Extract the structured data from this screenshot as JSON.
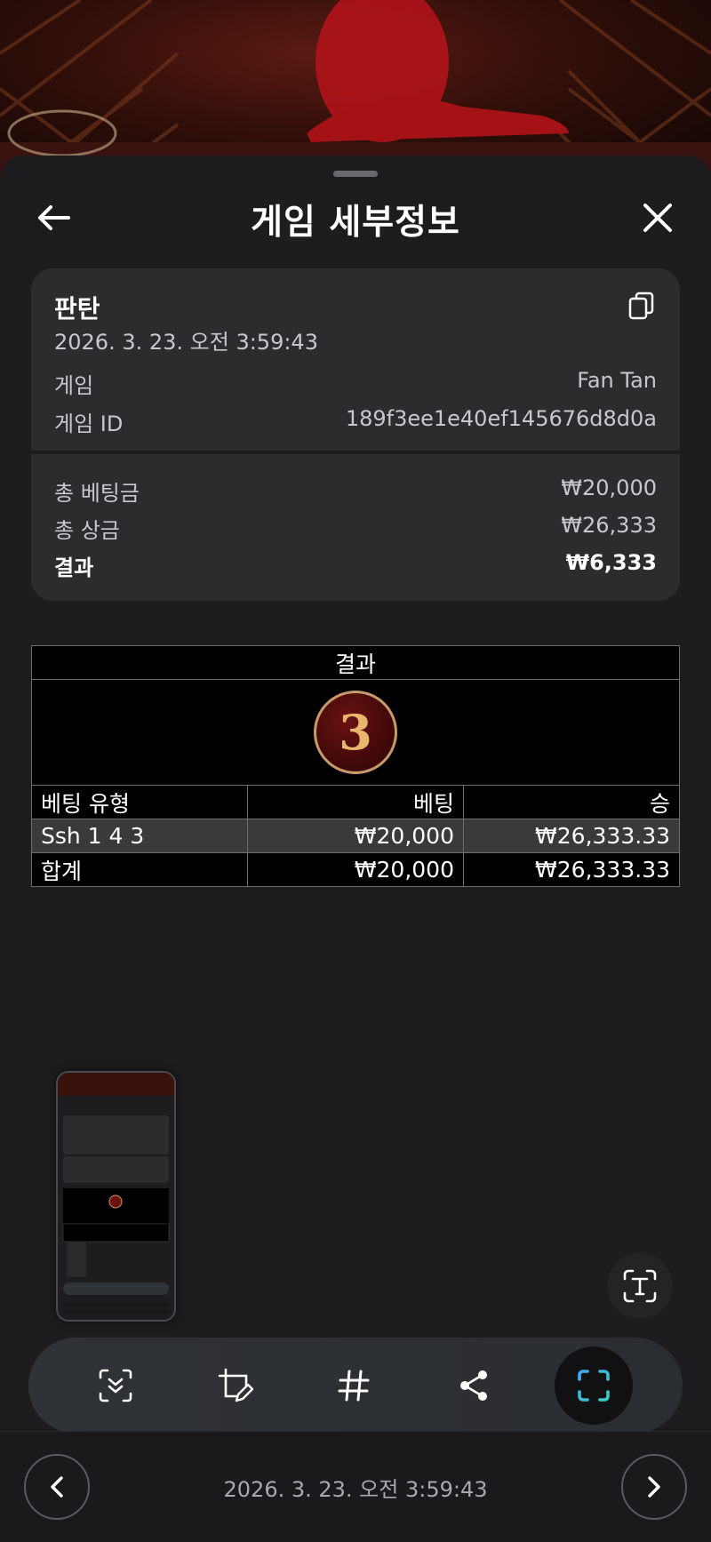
{
  "header": {
    "title": "게임 세부정보"
  },
  "summary": {
    "game_name": "판탄",
    "datetime": "2026. 3. 23. 오전 3:59:43",
    "game_label": "게임",
    "game_value": "Fan Tan",
    "game_id_label": "게임 ID",
    "game_id_value": "189f3ee1e40ef145676d8d0a",
    "total_bet_label": "총 베팅금",
    "total_bet_value": "₩20,000",
    "total_prize_label": "총 상금",
    "total_prize_value": "₩26,333",
    "result_label": "결과",
    "result_value": "₩6,333"
  },
  "results_table": {
    "caption": "결과",
    "result_number": "3",
    "columns": [
      "베팅 유형",
      "베팅",
      "승"
    ],
    "rows": [
      [
        "Ssh 1 4 3",
        "₩20,000",
        "₩26,333.33"
      ],
      [
        "합계",
        "₩20,000",
        "₩26,333.33"
      ]
    ]
  },
  "toolbar": {
    "icons": [
      "scroll-capture-icon",
      "edit-icon",
      "hashtag-icon",
      "share-icon",
      "screenshot-icon"
    ],
    "active": "screenshot-icon"
  },
  "footer": {
    "datetime": "2026. 3. 23. 오전 3:59:43"
  },
  "colors": {
    "accent_blue": "#3fa9f5",
    "accent_teal": "#36d0c0",
    "coin_gold": "#e9b66d"
  }
}
